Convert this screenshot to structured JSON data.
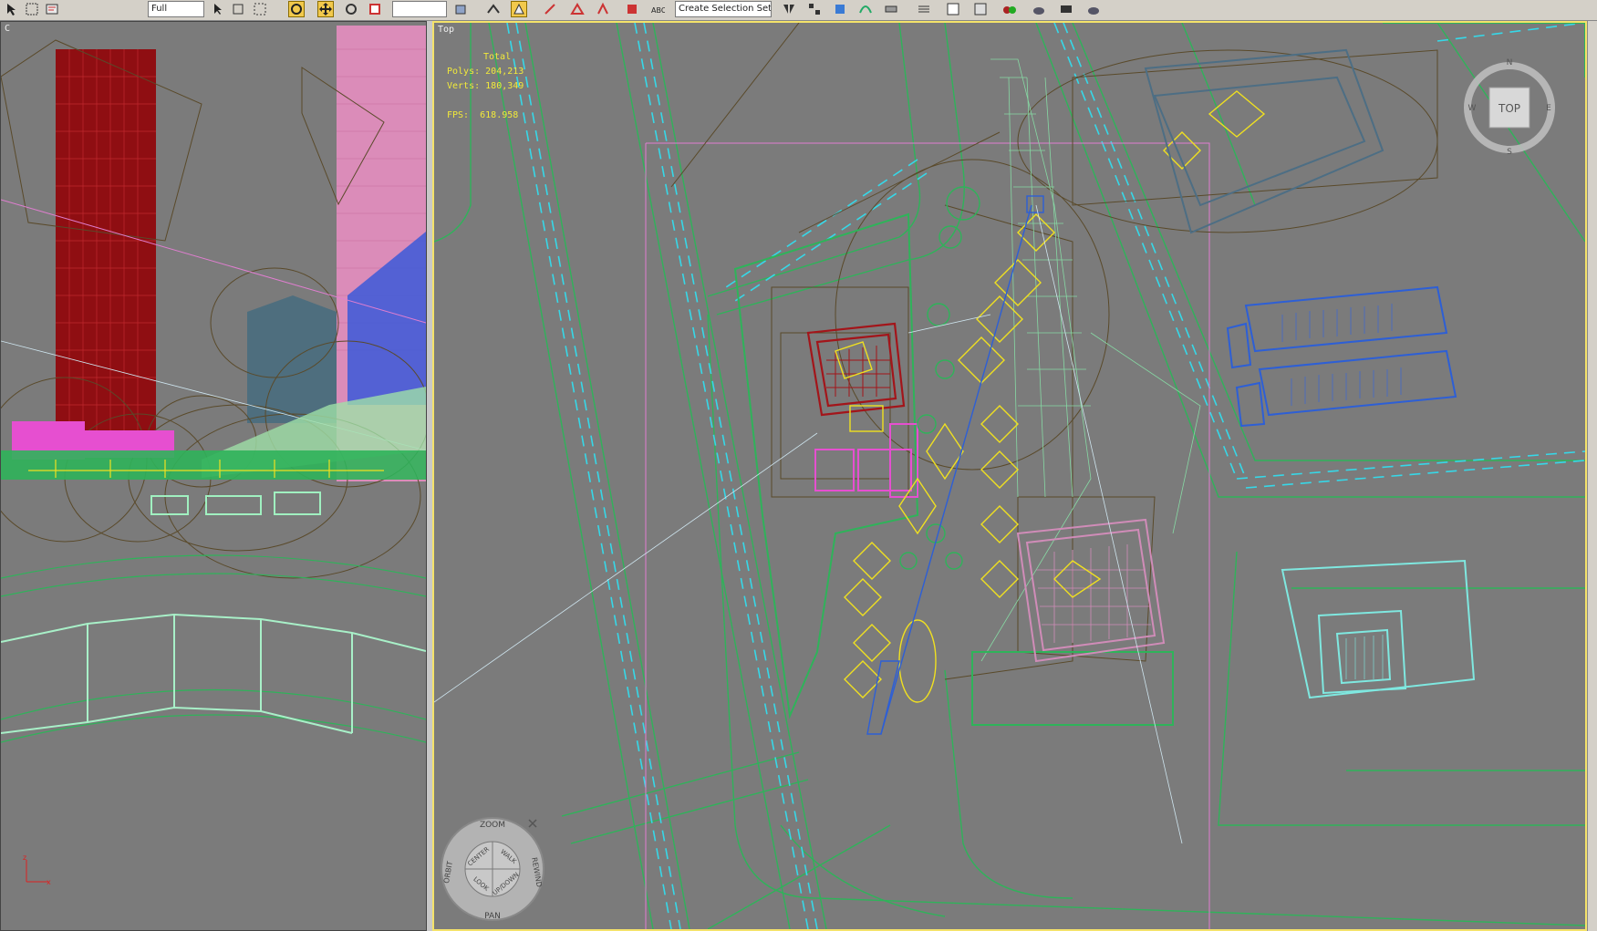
{
  "toolbar": {
    "combo_view": "Full",
    "combo_selection": "Create Selection Set",
    "icons": [
      "select-arrow-icon",
      "select-region-icon",
      "select-by-name-icon",
      "window-crossing-icon",
      "move-icon",
      "rotate-icon",
      "scale-icon",
      "snap-icon",
      "angle-snap-icon",
      "percent-snap-icon",
      "mirror-icon",
      "align-icon",
      "layer-icon",
      "curve-editor-icon",
      "schematic-icon",
      "material-editor-icon",
      "render-setup-icon",
      "rendered-frame-icon",
      "render-icon"
    ]
  },
  "viewports": {
    "left": {
      "label": "C"
    },
    "top": {
      "label": "Top",
      "stats": {
        "total_label": "Total",
        "polys_label": "Polys:",
        "polys_value": "204,213",
        "verts_label": "Verts:",
        "verts_value": "180,349",
        "fps_label": "FPS:",
        "fps_value": "618.958"
      },
      "viewcube": {
        "face": "TOP",
        "n": "N",
        "w": "W",
        "e": "E",
        "s": "S"
      },
      "steering_wheel": {
        "zoom": "ZOOM",
        "orbit": "ORBIT",
        "center": "CENTER",
        "walk": "WALK",
        "rewind": "REWIND",
        "look": "LOOK",
        "updown": "UP/DOWN",
        "pan": "PAN"
      }
    }
  },
  "axis": {
    "x": "x",
    "z": "z"
  },
  "colors": {
    "viewport_bg": "#7b7b7b",
    "active_border": "#f4e26a",
    "stats_text": "#f2ea3a",
    "wire_green": "#2fb35a",
    "wire_cyan": "#36d8e8",
    "wire_pink": "#e08ab8",
    "wire_yellow": "#f0e020",
    "wire_blue": "#2d5fd6",
    "wire_red": "#a3151a",
    "wire_brown": "#5a4a2a"
  }
}
